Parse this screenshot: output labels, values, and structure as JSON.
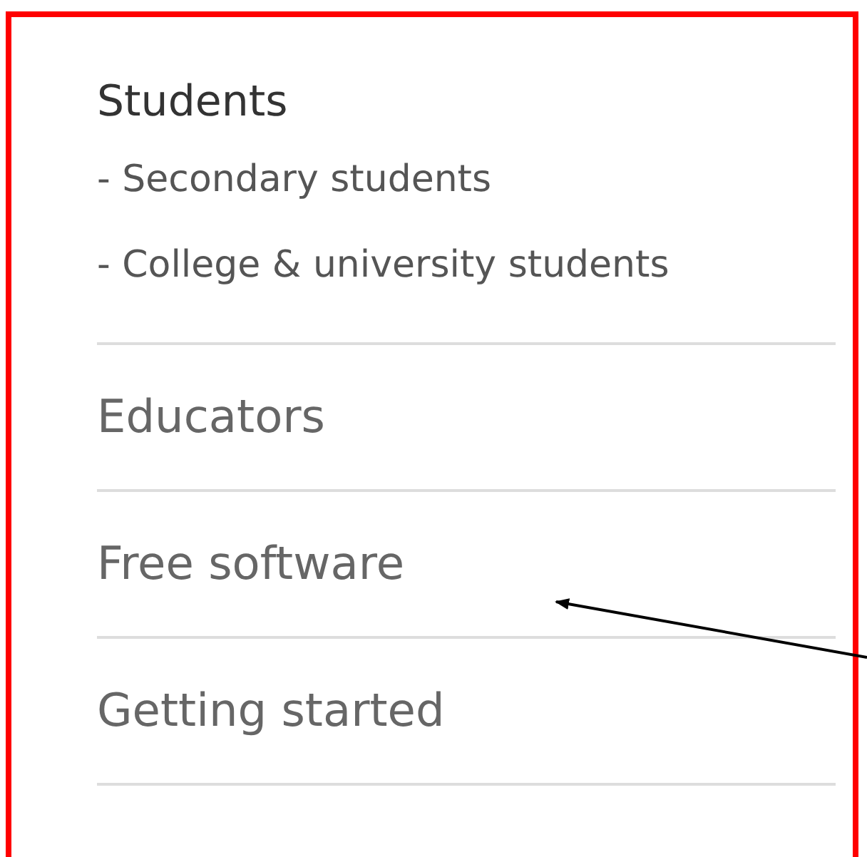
{
  "section": {
    "heading": "Students",
    "subitems": [
      "- Secondary students",
      "- College & university students"
    ]
  },
  "menu_items": [
    {
      "label": "Educators"
    },
    {
      "label": "Free software"
    },
    {
      "label": "Getting started"
    }
  ]
}
